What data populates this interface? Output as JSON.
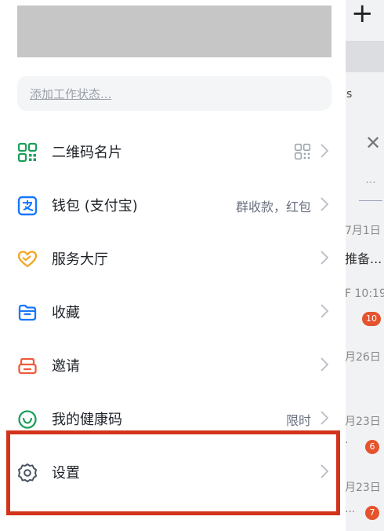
{
  "status": {
    "placeholder": "添加工作状态..."
  },
  "menu": [
    {
      "id": "qr",
      "label": "二维码名片",
      "icon": "qr-code-icon"
    },
    {
      "id": "wallet",
      "label": "钱包 (支付宝)",
      "extra": "群收款，红包",
      "icon": "alipay-icon"
    },
    {
      "id": "service",
      "label": "服务大厅",
      "icon": "heart-hands-icon"
    },
    {
      "id": "favorites",
      "label": "收藏",
      "icon": "folder-icon"
    },
    {
      "id": "invite",
      "label": "邀请",
      "icon": "invite-icon"
    },
    {
      "id": "health",
      "label": "我的健康码",
      "extra": "限时",
      "icon": "health-heart-icon"
    },
    {
      "id": "settings",
      "label": "设置",
      "icon": "gear-icon"
    }
  ],
  "background": {
    "chip_text": "s",
    "dots": "···",
    "items": [
      {
        "date": "7月1日",
        "text": "推备..."
      },
      {
        "date": "F 10:19",
        "badge": "10"
      },
      {
        "date": "月26日"
      },
      {
        "date": "月23日",
        "badge": "6",
        "prefix": "·"
      },
      {
        "date": "月23日",
        "badge": "7",
        "prefix": "..."
      }
    ]
  },
  "colors": {
    "qr": "#1aa05a",
    "wallet": "#1677ff",
    "service": "#f5a623",
    "favorites": "#1677ff",
    "invite": "#ef5a3c",
    "health": "#1aa05a",
    "settings": "#4b5563",
    "highlight": "#d2341b"
  }
}
